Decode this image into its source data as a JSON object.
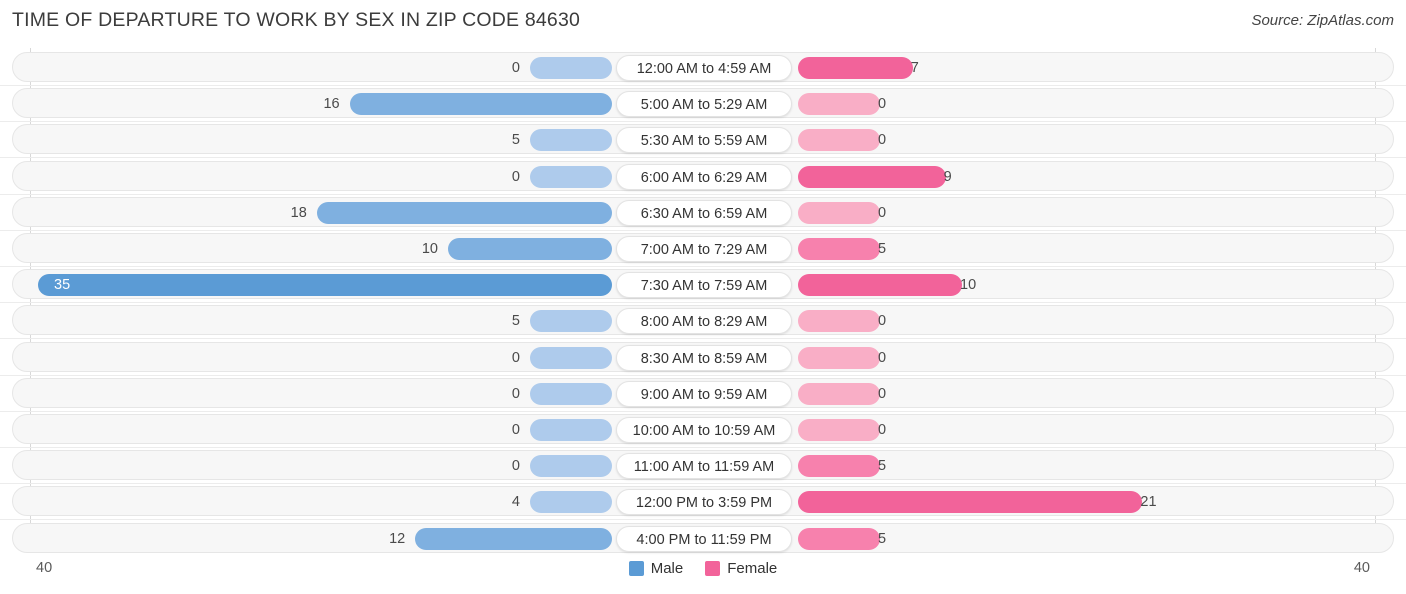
{
  "header": {
    "title": "TIME OF DEPARTURE TO WORK BY SEX IN ZIP CODE 84630",
    "source": "Source: ZipAtlas.com"
  },
  "legend": {
    "male_label": "Male",
    "female_label": "Female",
    "male_color": "#5b9bd5",
    "female_color": "#f2639a"
  },
  "axis": {
    "left_tick": "40",
    "right_tick": "40"
  },
  "colors": {
    "male_strong": "#5b9bd5",
    "male_mid": "#7fb0e0",
    "male_light": "#aecbec",
    "female_strong": "#f2639a",
    "female_mid": "#f781ad",
    "female_light": "#f9aec6",
    "track": "#f7f7f7",
    "track_border": "#e6e6e6"
  },
  "chart_data": {
    "type": "bar",
    "subtype": "diverging-horizontal",
    "title": "TIME OF DEPARTURE TO WORK BY SEX IN ZIP CODE 84630",
    "xlabel": "",
    "ylabel": "",
    "xlim": [
      40,
      40
    ],
    "grid": false,
    "legend_position": "bottom-center",
    "categories": [
      "12:00 AM to 4:59 AM",
      "5:00 AM to 5:29 AM",
      "5:30 AM to 5:59 AM",
      "6:00 AM to 6:29 AM",
      "6:30 AM to 6:59 AM",
      "7:00 AM to 7:29 AM",
      "7:30 AM to 7:59 AM",
      "8:00 AM to 8:29 AM",
      "8:30 AM to 8:59 AM",
      "9:00 AM to 9:59 AM",
      "10:00 AM to 10:59 AM",
      "11:00 AM to 11:59 AM",
      "12:00 PM to 3:59 PM",
      "4:00 PM to 11:59 PM"
    ],
    "series": [
      {
        "name": "Male",
        "values": [
          0,
          16,
          5,
          0,
          18,
          10,
          35,
          5,
          0,
          0,
          0,
          0,
          4,
          12
        ]
      },
      {
        "name": "Female",
        "values": [
          7,
          0,
          0,
          9,
          0,
          5,
          10,
          0,
          0,
          0,
          0,
          5,
          21,
          5
        ]
      }
    ]
  },
  "rows": [
    {
      "category": "12:00 AM to 4:59 AM",
      "male": "0",
      "female": "7"
    },
    {
      "category": "5:00 AM to 5:29 AM",
      "male": "16",
      "female": "0"
    },
    {
      "category": "5:30 AM to 5:59 AM",
      "male": "5",
      "female": "0"
    },
    {
      "category": "6:00 AM to 6:29 AM",
      "male": "0",
      "female": "9"
    },
    {
      "category": "6:30 AM to 6:59 AM",
      "male": "18",
      "female": "0"
    },
    {
      "category": "7:00 AM to 7:29 AM",
      "male": "10",
      "female": "5"
    },
    {
      "category": "7:30 AM to 7:59 AM",
      "male": "35",
      "female": "10"
    },
    {
      "category": "8:00 AM to 8:29 AM",
      "male": "5",
      "female": "0"
    },
    {
      "category": "8:30 AM to 8:59 AM",
      "male": "0",
      "female": "0"
    },
    {
      "category": "9:00 AM to 9:59 AM",
      "male": "0",
      "female": "0"
    },
    {
      "category": "10:00 AM to 10:59 AM",
      "male": "0",
      "female": "0"
    },
    {
      "category": "11:00 AM to 11:59 AM",
      "male": "0",
      "female": "5"
    },
    {
      "category": "12:00 PM to 3:59 PM",
      "male": "4",
      "female": "21"
    },
    {
      "category": "4:00 PM to 11:59 PM",
      "male": "12",
      "female": "5"
    }
  ]
}
